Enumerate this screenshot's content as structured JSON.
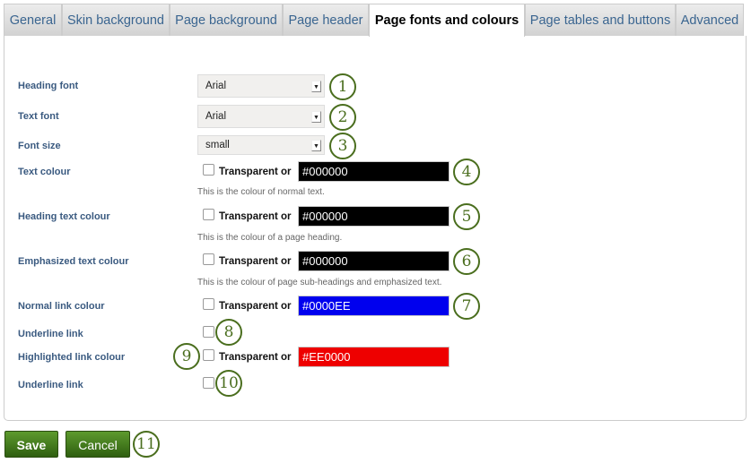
{
  "tabs": [
    {
      "label": "General"
    },
    {
      "label": "Skin background"
    },
    {
      "label": "Page background"
    },
    {
      "label": "Page header"
    },
    {
      "label": "Page fonts and colours"
    },
    {
      "label": "Page tables and buttons"
    },
    {
      "label": "Advanced"
    }
  ],
  "active_tab": "Page fonts and colours",
  "fields": {
    "heading_font": {
      "label": "Heading font",
      "value": "Arial"
    },
    "text_font": {
      "label": "Text font",
      "value": "Arial"
    },
    "font_size": {
      "label": "Font size",
      "value": "small"
    },
    "text_colour": {
      "label": "Text colour",
      "transparent": "Transparent or",
      "value": "#000000",
      "desc": "This is the colour of normal text."
    },
    "heading_text_colour": {
      "label": "Heading text colour",
      "transparent": "Transparent or",
      "value": "#000000",
      "desc": "This is the colour of a page heading."
    },
    "emphasized_text_colour": {
      "label": "Emphasized text colour",
      "transparent": "Transparent or",
      "value": "#000000",
      "desc": "This is the colour of page sub-headings and emphasized text."
    },
    "normal_link_colour": {
      "label": "Normal link colour",
      "transparent": "Transparent or",
      "value": "#0000EE"
    },
    "underline_link_1": {
      "label": "Underline link"
    },
    "highlighted_link_colour": {
      "label": "Highlighted link colour",
      "transparent": "Transparent or",
      "value": "#EE0000"
    },
    "underline_link_2": {
      "label": "Underline link"
    }
  },
  "callouts": [
    "1",
    "2",
    "3",
    "4",
    "5",
    "6",
    "7",
    "8",
    "9",
    "10",
    "11"
  ],
  "buttons": {
    "save": "Save",
    "cancel": "Cancel"
  },
  "colors": {
    "accent": "#3a6590",
    "button": "#3f7a1c",
    "callout": "#4a6e1e"
  }
}
